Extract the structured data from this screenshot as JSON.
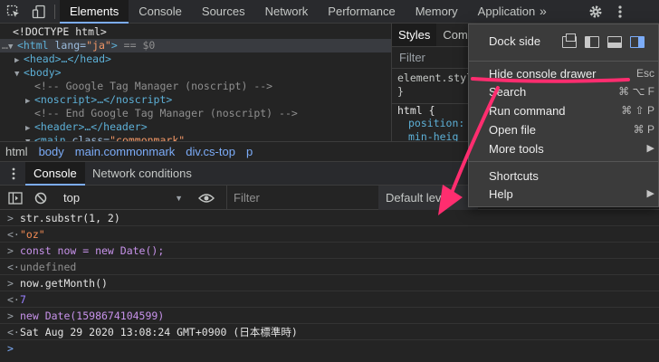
{
  "toolbar": {
    "tabs": [
      "Elements",
      "Console",
      "Sources",
      "Network",
      "Performance",
      "Memory",
      "Application"
    ],
    "more_tabs_glyph": "»",
    "icons": [
      "inspect-icon",
      "device-toggle-icon",
      "settings-gear-icon",
      "more-options-icon"
    ]
  },
  "elements": {
    "lines": [
      {
        "plain": "<!DOCTYPE html>"
      },
      {
        "prefix": "…",
        "open": "<html",
        "attr": " lang=",
        "val": "\"ja\"",
        "close": ">",
        "suffix": " == $0"
      },
      {
        "tag": "<head>…</head>"
      },
      {
        "tag": "<body>"
      },
      {
        "comment": "<!-- Google Tag Manager (noscript) -->"
      },
      {
        "tag": "<noscript>…</noscript>"
      },
      {
        "comment": "<!-- End Google Tag Manager (noscript) -->"
      },
      {
        "tag": "<header>…</header>"
      },
      {
        "open": "<main",
        "attr": " class=",
        "val": "\"commonmark\"",
        "close": ""
      }
    ]
  },
  "styles": {
    "tabs": [
      "Styles",
      "Com"
    ],
    "filter_placeholder": "Filter",
    "lines": [
      "element.style",
      "}",
      "html {",
      "position:",
      "min-heig",
      "}"
    ]
  },
  "breadcrumb": [
    "html",
    "body",
    "main.commonmark",
    "div.cs-top",
    "p"
  ],
  "drawer": {
    "tabs": [
      "Console",
      "Network conditions"
    ]
  },
  "console_toolbar": {
    "context": "top",
    "filter_placeholder": "Filter",
    "levels": "Default lev"
  },
  "console": {
    "lines": [
      {
        "type": "in",
        "text": "str.substr(1, 2)"
      },
      {
        "type": "out",
        "text": "\"oz\""
      },
      {
        "type": "in",
        "text": "const now = new Date();"
      },
      {
        "type": "out",
        "text": "undefined"
      },
      {
        "type": "in",
        "text": "now.getMonth()"
      },
      {
        "type": "out",
        "text": "7"
      },
      {
        "type": "in",
        "text": "new Date(1598674104599)"
      },
      {
        "type": "out",
        "text": "Sat Aug 29 2020 13:08:24 GMT+0900 (日本標準時)"
      }
    ]
  },
  "menu": {
    "dock_label": "Dock side",
    "items": [
      {
        "label": "Hide console drawer",
        "shortcut": "Esc"
      },
      {
        "label": "Search",
        "shortcut": "⌘ ⌥ F"
      },
      {
        "label": "Run command",
        "shortcut": "⌘ ⇧ P"
      },
      {
        "label": "Open file",
        "shortcut": "⌘ P"
      },
      {
        "label": "More tools",
        "shortcut": "▶"
      },
      {
        "label": "Shortcuts",
        "shortcut": ""
      },
      {
        "label": "Help",
        "shortcut": "▶"
      }
    ]
  },
  "colors": {
    "accent": "#7cacf8",
    "annotation": "#ff2d6f",
    "menu_bg": "#3b3b3b",
    "panel_bg": "#242424"
  }
}
